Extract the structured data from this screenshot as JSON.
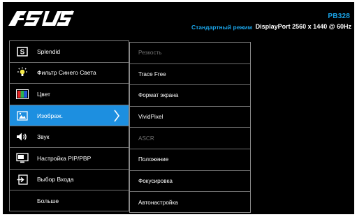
{
  "header": {
    "brand": "ASUS",
    "model": "PB328",
    "mode": "Стандартный режим",
    "signal": "DisplayPort 2560 x 1440 @ 60Hz"
  },
  "menu": {
    "items": [
      {
        "label": "Splendid",
        "icon": "splendid-s-icon"
      },
      {
        "label": "Фильтр Синего Света",
        "icon": "sun-bulb-icon"
      },
      {
        "label": "Цвет",
        "icon": "color-bars-icon"
      },
      {
        "label": "Изображ.",
        "icon": "image-icon",
        "selected": true
      },
      {
        "label": "Звук",
        "icon": "speaker-icon"
      },
      {
        "label": "Настройка PIP/PBP",
        "icon": "pip-icon"
      },
      {
        "label": "Выбор Входа",
        "icon": "input-select-icon"
      },
      {
        "label": "Больше",
        "icon": ""
      }
    ]
  },
  "submenu": {
    "items": [
      {
        "label": "Резкость",
        "disabled": true
      },
      {
        "label": "Trace Free"
      },
      {
        "label": "Формат экрана"
      },
      {
        "label": "VividPixel"
      },
      {
        "label": "ASCR",
        "disabled": true
      },
      {
        "label": "Положение"
      },
      {
        "label": "Фокусировка"
      },
      {
        "label": "Автонастройка"
      }
    ]
  },
  "colors": {
    "accent": "#1d8fe0",
    "header_blue": "#1aa4e8",
    "background": "#000000",
    "disabled_text": "#6f6f6f"
  }
}
